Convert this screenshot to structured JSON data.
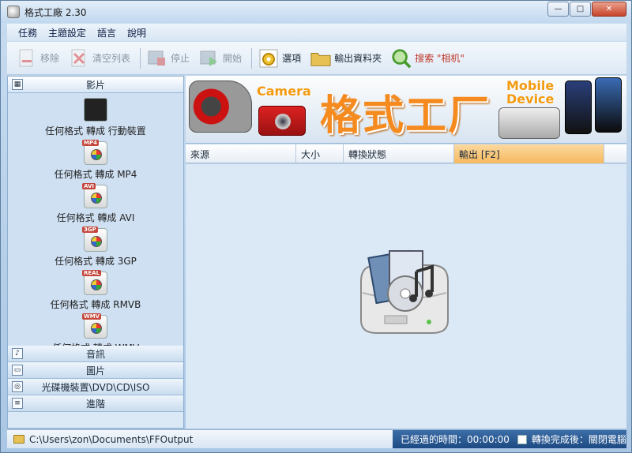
{
  "window": {
    "title": "格式工廠 2.30"
  },
  "menu": [
    "任務",
    "主題設定",
    "語言",
    "說明"
  ],
  "toolbar": {
    "remove": "移除",
    "clear_list": "清空列表",
    "stop": "停止",
    "start": "開始",
    "options": "選項",
    "output_folder": "輸出資料夾",
    "search": "搜索 \"相机\""
  },
  "sidebar": {
    "video_header": "影片",
    "formats": [
      {
        "label": "任何格式 轉成 行動裝置",
        "tag": ""
      },
      {
        "label": "任何格式 轉成 MP4",
        "tag": "MP4"
      },
      {
        "label": "任何格式 轉成 AVI",
        "tag": "AVI"
      },
      {
        "label": "任何格式 轉成 3GP",
        "tag": "3GP"
      },
      {
        "label": "任何格式 轉成 RMVB",
        "tag": "REAL"
      },
      {
        "label": "任何格式 轉成 WMV",
        "tag": "WMV"
      }
    ],
    "categories": [
      "音訊",
      "圖片",
      "光碟機裝置\\DVD\\CD\\ISO",
      "進階"
    ]
  },
  "banner": {
    "camera_label": "Camera",
    "brand": "格式工厂",
    "mobile_label_1": "Mobile",
    "mobile_label_2": "Device"
  },
  "table": {
    "columns": [
      "來源",
      "大小",
      "轉換狀態",
      "輸出 [F2]"
    ]
  },
  "status": {
    "output_path": "C:\\Users\\zon\\Documents\\FFOutput",
    "elapsed": "已經過的時間：00:00:00",
    "after_convert": "轉換完成後：關閉電腦"
  },
  "colors": {
    "accent_orange": "#f58a1f",
    "selected_column": "#f5b95e",
    "panel_blue": "#dbe8f6"
  }
}
